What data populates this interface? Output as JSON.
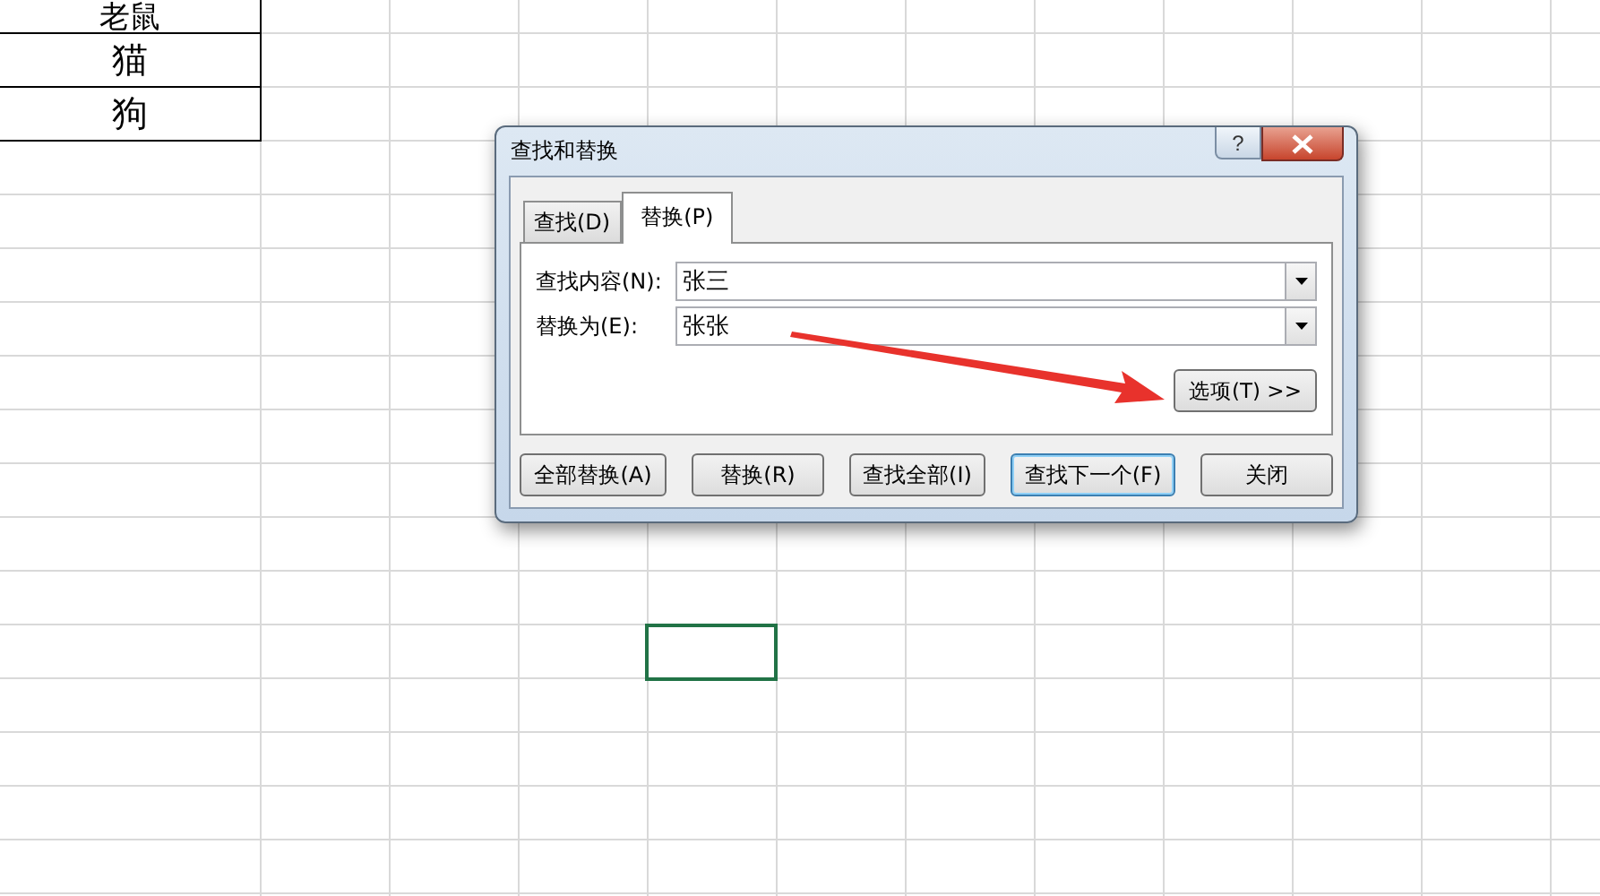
{
  "sheet": {
    "cells": [
      "老鼠",
      "猫",
      "狗"
    ]
  },
  "dialog": {
    "title": "查找和替换",
    "help": "?",
    "tabs": [
      {
        "label": "查找(D)",
        "selected": false
      },
      {
        "label": "替换(P)",
        "selected": true
      }
    ],
    "fields": [
      {
        "label": "查找内容(N):",
        "value": "张三"
      },
      {
        "label": "替换为(E):",
        "value": "张张"
      }
    ],
    "options_button": "选项(T) >>",
    "buttons": [
      {
        "label": "全部替换(A)",
        "default": false
      },
      {
        "label": "替换(R)",
        "default": false
      },
      {
        "label": "查找全部(I)",
        "default": false
      },
      {
        "label": "查找下一个(F)",
        "default": true
      },
      {
        "label": "关闭",
        "default": false
      }
    ]
  }
}
